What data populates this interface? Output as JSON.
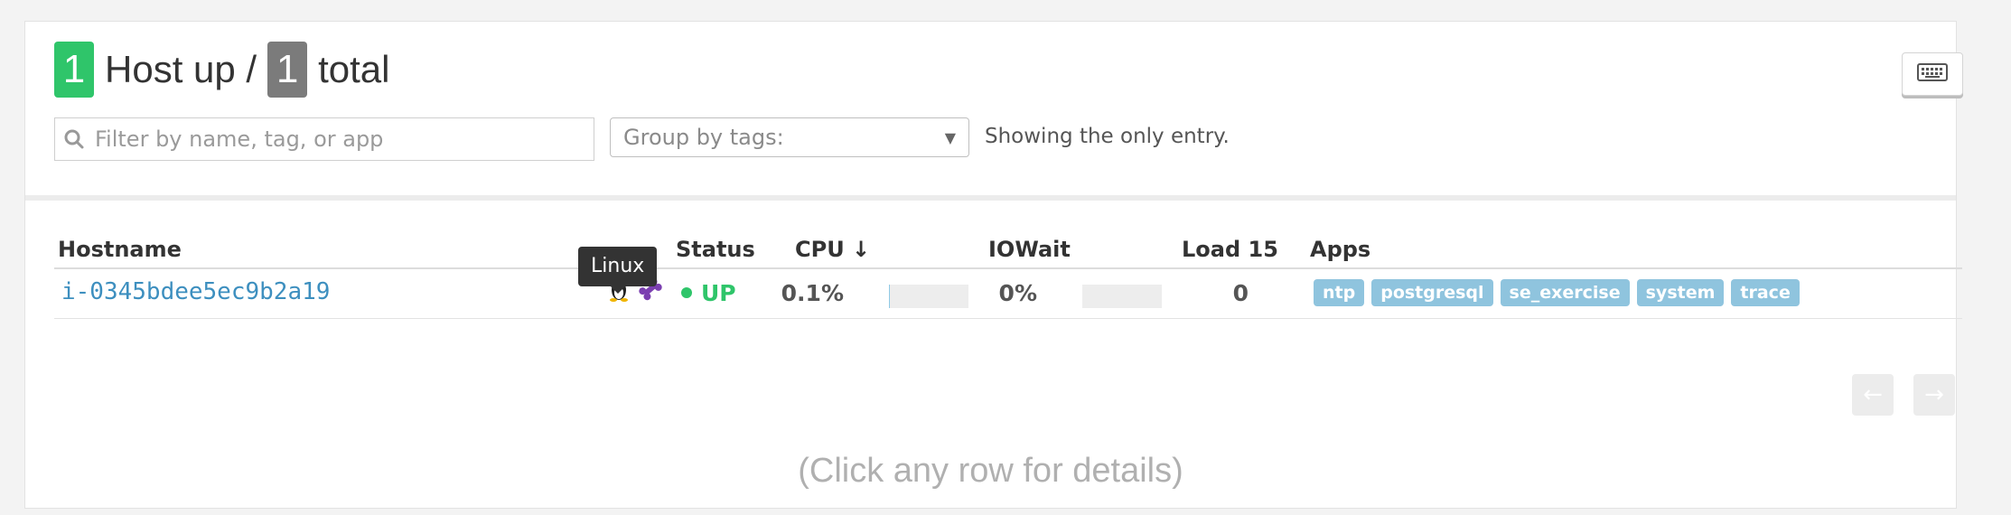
{
  "summary": {
    "up_count": "1",
    "up_label": "Host up /",
    "total_count": "1",
    "total_label": "total"
  },
  "toolbar": {
    "keyboard_icon": "keyboard-icon"
  },
  "filter": {
    "placeholder": "Filter by name, tag, or app",
    "value": ""
  },
  "group_by": {
    "label": "Group by tags:"
  },
  "showing_text": "Showing the only entry.",
  "table": {
    "columns": {
      "hostname": "Hostname",
      "status": "Status",
      "cpu": "CPU ↓",
      "iowait": "IOWait",
      "load15": "Load 15",
      "apps": "Apps"
    },
    "rows": [
      {
        "hostname": "i-0345bdee5ec9b2a19",
        "os_icon": "linux-icon",
        "agent_icon": "bone-icon",
        "status": "UP",
        "cpu": "0.1%",
        "cpu_fraction": 0.001,
        "iowait": "0%",
        "iowait_fraction": 0,
        "load15": "0",
        "apps": [
          "ntp",
          "postgresql",
          "se_exercise",
          "system",
          "trace"
        ]
      }
    ]
  },
  "tooltip": "Linux",
  "pager": {
    "prev": "←",
    "next": "→"
  },
  "hint": "(Click any row for details)",
  "colors": {
    "up": "#2fc56a",
    "total": "#7b7b7b",
    "link": "#3d8fbf",
    "tag": "#8fc4de"
  }
}
